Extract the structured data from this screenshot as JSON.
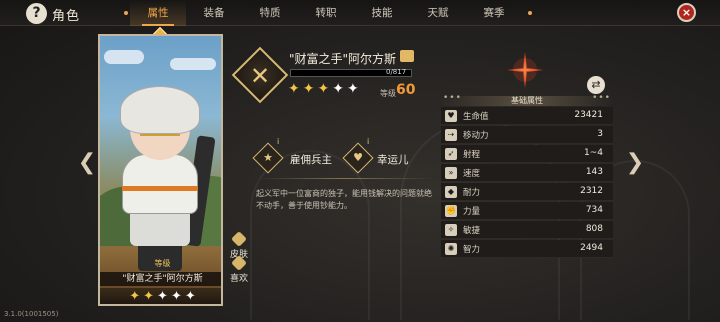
{
  "header": {
    "title": "角色",
    "help_icon": "?",
    "close_icon": "×"
  },
  "tabs": [
    {
      "label": "属性",
      "active": true
    },
    {
      "label": "装备",
      "active": false
    },
    {
      "label": "特质",
      "active": false
    },
    {
      "label": "转职",
      "active": false
    },
    {
      "label": "技能",
      "active": false
    },
    {
      "label": "天赋",
      "active": false
    },
    {
      "label": "赛季",
      "active": false
    }
  ],
  "card": {
    "name": "\"财富之手\"阿尔方斯",
    "level_label": "等级",
    "stars_gold": 2,
    "stars_white": 3,
    "side_buttons": [
      {
        "label": "皮肤"
      },
      {
        "label": "喜欢"
      }
    ]
  },
  "hero": {
    "name": "\"财富之手\"阿尔方斯",
    "xp_text": "0/817",
    "xp_fraction": 0,
    "level_label": "等级",
    "level_value": "60",
    "stars": 5
  },
  "traits": [
    {
      "label": "雇佣兵主",
      "icon": "mercenary-icon"
    },
    {
      "label": "幸运儿",
      "icon": "lucky-icon"
    }
  ],
  "description": "起义军中一位富商的独子，能用钱解决的问题就绝不动手，善于使用钞能力。",
  "stats": {
    "header": "基础属性",
    "rows": [
      {
        "label": "生命值",
        "value": "23421",
        "icon": "heart-icon"
      },
      {
        "label": "移动力",
        "value": "3",
        "icon": "boot-icon"
      },
      {
        "label": "射程",
        "value": "1~4",
        "icon": "bow-icon"
      },
      {
        "label": "速度",
        "value": "143",
        "icon": "wing-icon"
      },
      {
        "label": "耐力",
        "value": "2312",
        "icon": "shield-icon"
      },
      {
        "label": "力量",
        "value": "734",
        "icon": "fist-icon"
      },
      {
        "label": "敏捷",
        "value": "808",
        "icon": "feather-icon"
      },
      {
        "label": "智力",
        "value": "2494",
        "icon": "brain-icon"
      }
    ]
  },
  "version": "3.1.0(1001505)",
  "colors": {
    "accent": "#f2a64a",
    "level": "#f29a37",
    "close": "#b1261c"
  }
}
